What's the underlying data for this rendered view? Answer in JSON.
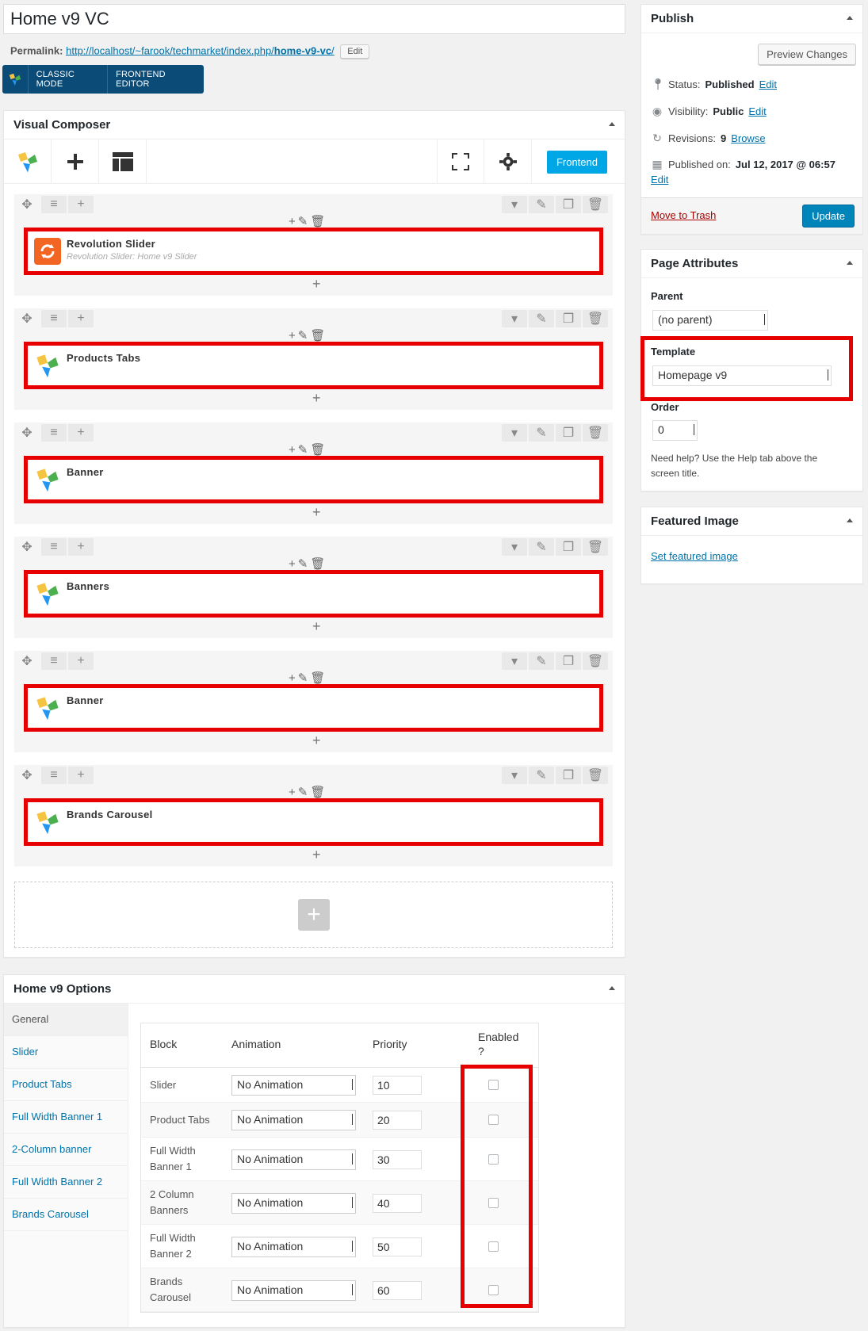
{
  "title": "Home v9 VC",
  "permalink": {
    "label": "Permalink:",
    "url_prefix": "http://localhost/~farook/techmarket/index.php/",
    "slug": "home-v9-vc",
    "url_suffix": "/",
    "edit_label": "Edit"
  },
  "mode_bar": {
    "classic": "CLASSIC MODE",
    "frontend": "FRONTEND EDITOR"
  },
  "vc": {
    "title": "Visual Composer",
    "frontend_button": "Frontend",
    "rows": [
      {
        "name": "Revolution Slider",
        "subtitle": "Revolution Slider: Home v9 Slider",
        "icon": "revolution-slider-icon"
      },
      {
        "name": "Products Tabs",
        "subtitle": "",
        "icon": "vc-logo-icon"
      },
      {
        "name": "Banner",
        "subtitle": "",
        "icon": "vc-logo-icon"
      },
      {
        "name": "Banners",
        "subtitle": "",
        "icon": "vc-logo-icon"
      },
      {
        "name": "Banner",
        "subtitle": "",
        "icon": "vc-logo-icon"
      },
      {
        "name": "Brands Carousel",
        "subtitle": "",
        "icon": "vc-logo-icon"
      }
    ]
  },
  "options": {
    "title": "Home v9 Options",
    "tabs": [
      "General",
      "Slider",
      "Product Tabs",
      "Full Width Banner 1",
      "2-Column banner",
      "Full Width Banner 2",
      "Brands Carousel"
    ],
    "headers": {
      "block": "Block",
      "animation": "Animation",
      "priority": "Priority",
      "enabled": "Enabled ?"
    },
    "rows": [
      {
        "block": "Slider",
        "animation": "No Animation",
        "priority": "10"
      },
      {
        "block": "Product Tabs",
        "animation": "No Animation",
        "priority": "20"
      },
      {
        "block": "Full Width Banner 1",
        "animation": "No Animation",
        "priority": "30"
      },
      {
        "block": "2 Column Banners",
        "animation": "No Animation",
        "priority": "40"
      },
      {
        "block": "Full Width Banner 2",
        "animation": "No Animation",
        "priority": "50"
      },
      {
        "block": "Brands Carousel",
        "animation": "No Animation",
        "priority": "60"
      }
    ]
  },
  "publish": {
    "title": "Publish",
    "preview": "Preview Changes",
    "status_label": "Status:",
    "status_value": "Published",
    "visibility_label": "Visibility:",
    "visibility_value": "Public",
    "revisions_label": "Revisions:",
    "revisions_value": "9",
    "browse": "Browse",
    "published_label": "Published on:",
    "published_value": "Jul 12, 2017 @ 06:57",
    "edit": "Edit",
    "trash": "Move to Trash",
    "update": "Update"
  },
  "attributes": {
    "title": "Page Attributes",
    "parent_label": "Parent",
    "parent_value": "(no parent)",
    "template_label": "Template",
    "template_value": "Homepage v9",
    "order_label": "Order",
    "order_value": "0",
    "help": "Need help? Use the Help tab above the screen title."
  },
  "featured": {
    "title": "Featured Image",
    "link": "Set featured image"
  },
  "colors": {
    "highlight": "#e60000",
    "primary": "#0085ba",
    "vc_blue": "#00a7e6",
    "mode_bar": "#0a4b78"
  }
}
